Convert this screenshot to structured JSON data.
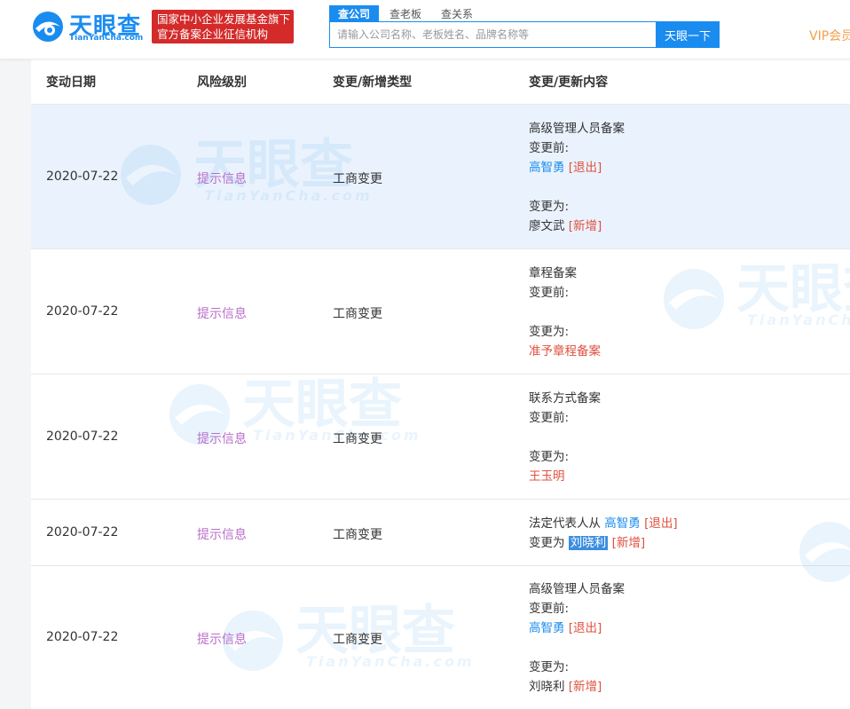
{
  "header": {
    "logo_text": "天眼查",
    "logo_sub": "TianYanCha.com",
    "badge_line1": "国家中小企业发展基金旗下",
    "badge_line2": "官方备案企业征信机构",
    "tabs": [
      "查公司",
      "查老板",
      "查关系"
    ],
    "search_placeholder": "请输入公司名称、老板姓名、品牌名称等",
    "search_button": "天眼一下",
    "vip": "VIP会员"
  },
  "table": {
    "columns": [
      "变动日期",
      "风险级别",
      "变更/新增类型",
      "变更/更新内容"
    ],
    "rows": [
      {
        "date": "2020-07-22",
        "risk": "提示信息",
        "type": "工商变更",
        "highlight": true,
        "lines": [
          [
            {
              "t": "高级管理人员备案"
            }
          ],
          [
            {
              "t": "变更前:"
            }
          ],
          [
            {
              "t": "高智勇",
              "c": "blue"
            },
            {
              "t": " [退出]",
              "c": "red"
            }
          ],
          [],
          [
            {
              "t": "变更为:"
            }
          ],
          [
            {
              "t": "廖文武"
            },
            {
              "t": " [新增]",
              "c": "red"
            }
          ]
        ]
      },
      {
        "date": "2020-07-22",
        "risk": "提示信息",
        "type": "工商变更",
        "lines": [
          [
            {
              "t": "章程备案"
            }
          ],
          [
            {
              "t": "变更前:"
            }
          ],
          [],
          [
            {
              "t": "变更为:"
            }
          ],
          [
            {
              "t": "准予章程备案",
              "c": "red"
            }
          ]
        ]
      },
      {
        "date": "2020-07-22",
        "risk": "提示信息",
        "type": "工商变更",
        "lines": [
          [
            {
              "t": "联系方式备案"
            }
          ],
          [
            {
              "t": "变更前:"
            }
          ],
          [],
          [
            {
              "t": "变更为:"
            }
          ],
          [
            {
              "t": "王玉明",
              "c": "red"
            }
          ]
        ]
      },
      {
        "date": "2020-07-22",
        "risk": "提示信息",
        "type": "工商变更",
        "lines": [
          [
            {
              "t": "法定代表人从 "
            },
            {
              "t": "高智勇",
              "c": "blue"
            },
            {
              "t": " [退出]",
              "c": "red"
            }
          ],
          [
            {
              "t": "变更为 "
            },
            {
              "t": "刘晓利",
              "c": "sel"
            },
            {
              "t": " [新增]",
              "c": "red"
            }
          ]
        ]
      },
      {
        "date": "2020-07-22",
        "risk": "提示信息",
        "type": "工商变更",
        "lines": [
          [
            {
              "t": "高级管理人员备案"
            }
          ],
          [
            {
              "t": "变更前:"
            }
          ],
          [
            {
              "t": "高智勇",
              "c": "blue"
            },
            {
              "t": " [退出]",
              "c": "red"
            }
          ],
          [],
          [
            {
              "t": "变更为:"
            }
          ],
          [
            {
              "t": "刘晓利"
            },
            {
              "t": " [新增]",
              "c": "red"
            }
          ]
        ]
      }
    ]
  },
  "watermark": {
    "text": "天眼查",
    "sub": "TianYanCha.com"
  }
}
